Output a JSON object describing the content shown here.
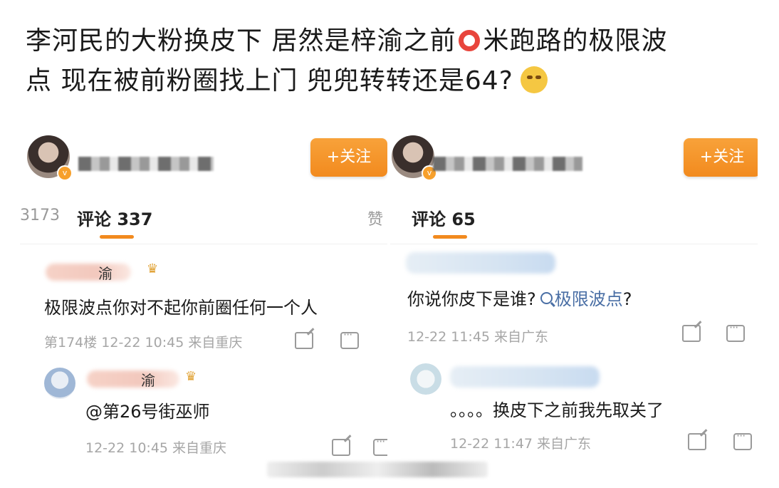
{
  "caption": {
    "line1_a": "李河民的大粉换皮下 居然是梓渝之前",
    "line1_b": "米跑路的极限波",
    "line2": "点 现在被前粉圈找上门 兜兜转转还是64?"
  },
  "left": {
    "follow_label": "+关注",
    "tab_repost": "3173",
    "tab_comments": "评论 337",
    "tab_likes": "赞",
    "comment1": {
      "name_char": "渝",
      "text": "极限波点你对不起你前圈任何一个人",
      "meta": "第174楼 12-22 10:45 来自重庆"
    },
    "comment2": {
      "name_char": "渝",
      "text": "@第26号街巫师",
      "meta": "12-22 10:45 来自重庆"
    }
  },
  "right": {
    "follow_label": "+关注",
    "tab_comments": "评论 65",
    "comment1": {
      "text_a": "你说你皮下是谁?",
      "text_kw": "极限波点",
      "text_b": "?",
      "meta": "12-22 11:45 来自广东"
    },
    "comment2": {
      "text": "。。。。换皮下之前我先取关了",
      "meta": "12-22 11:47 来自广东"
    }
  },
  "colors": {
    "accent": "#f28a1e",
    "link": "#4a6fa5",
    "ring": "#e8453c"
  }
}
